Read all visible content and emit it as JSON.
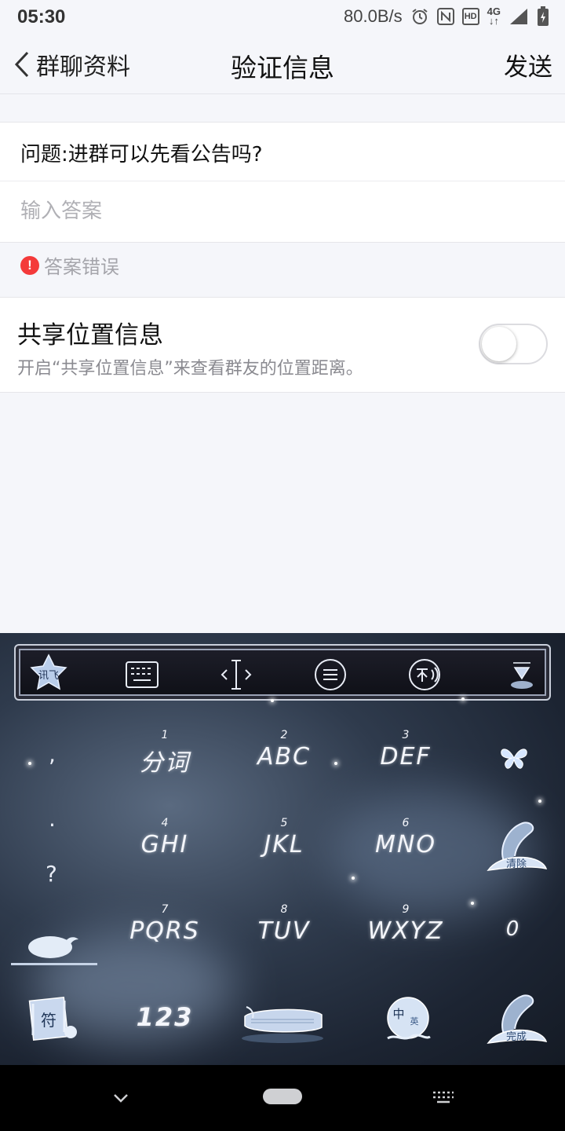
{
  "status_bar": {
    "time": "05:30",
    "net_speed": "80.0B/s",
    "icons": [
      "alarm-icon",
      "nfc-icon",
      "hd-icon",
      "4g-icon",
      "signal-icon",
      "battery-charging-icon"
    ],
    "hd": "HD",
    "network": "4G"
  },
  "header": {
    "back_label": "群聊资料",
    "title": "验证信息",
    "send_label": "发送"
  },
  "form": {
    "question": "问题:进群可以先看公告吗?",
    "answer_value": "",
    "answer_placeholder": "输入答案",
    "error_text": "答案错误"
  },
  "share_location": {
    "title": "共享位置信息",
    "description": "开启“共享位置信息”来查看群友的位置距离。",
    "enabled": false
  },
  "keyboard": {
    "toolbar_icons": [
      "ifly-logo-icon",
      "keyboard-icon",
      "cursor-icon",
      "menu-icon",
      "translate-icon",
      "hide-keyboard-icon"
    ],
    "toolbar_logo_text": "讯飞",
    "punctuation": [
      ",",
      ".",
      "?"
    ],
    "keys": [
      {
        "num": "1",
        "label": "分词"
      },
      {
        "num": "2",
        "label": "ABC"
      },
      {
        "num": "3",
        "label": "DEF"
      },
      {
        "num": "4",
        "label": "GHI"
      },
      {
        "num": "5",
        "label": "JKL"
      },
      {
        "num": "6",
        "label": "MNO"
      },
      {
        "num": "7",
        "label": "PQRS"
      },
      {
        "num": "8",
        "label": "TUV"
      },
      {
        "num": "9",
        "label": "WXYZ"
      }
    ],
    "zero_label": "0",
    "num_mode_label": "123",
    "delete_label": "清除",
    "enter_label": "完成",
    "symbol_label": "符",
    "lang_label_zh": "中",
    "lang_label_en": "英"
  },
  "colors": {
    "error": "#f43a3a",
    "background": "#f5f6fa"
  }
}
